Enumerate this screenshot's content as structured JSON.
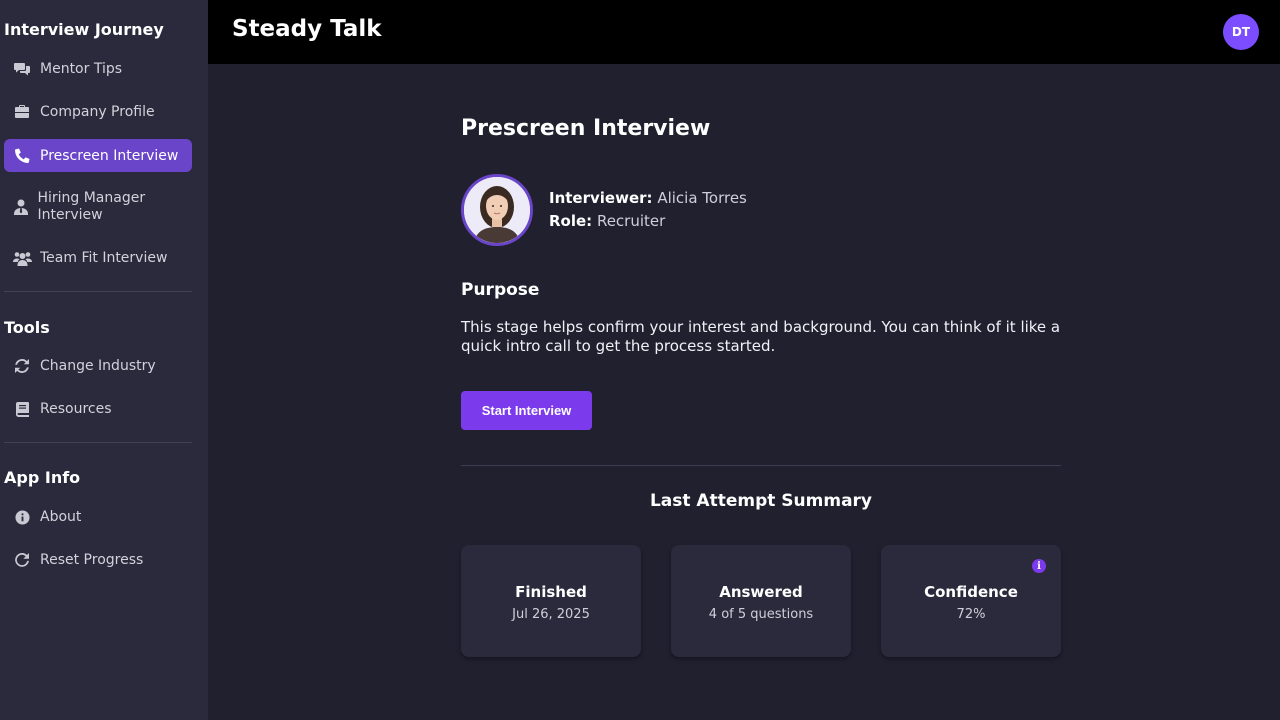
{
  "sidebar": {
    "journey_title": "Interview Journey",
    "journey_items": [
      {
        "label": "Mentor Tips",
        "icon": "comments-icon"
      },
      {
        "label": "Company Profile",
        "icon": "briefcase-icon"
      },
      {
        "label": "Prescreen Interview",
        "icon": "phone-icon",
        "active": true
      },
      {
        "label": "Hiring Manager Interview",
        "icon": "user-tie-icon"
      },
      {
        "label": "Team Fit Interview",
        "icon": "users-icon"
      }
    ],
    "tools_title": "Tools",
    "tools_items": [
      {
        "label": "Change Industry",
        "icon": "refresh-icon"
      },
      {
        "label": "Resources",
        "icon": "book-icon"
      }
    ],
    "appinfo_title": "App Info",
    "appinfo_items": [
      {
        "label": "About",
        "icon": "info-circle-icon"
      },
      {
        "label": "Reset Progress",
        "icon": "reset-icon"
      }
    ]
  },
  "header": {
    "app_title": "Steady Talk",
    "user_initials": "DT"
  },
  "main": {
    "page_title": "Prescreen Interview",
    "interviewer_label": "Interviewer:",
    "interviewer_name": "Alicia Torres",
    "role_label": "Role:",
    "role_value": "Recruiter",
    "purpose_title": "Purpose",
    "purpose_text": "This stage helps confirm your interest and background. You can think of it like a quick intro call to get the process started.",
    "start_button": "Start Interview",
    "summary_title": "Last Attempt Summary",
    "cards": [
      {
        "label": "Finished",
        "value": "Jul 26, 2025"
      },
      {
        "label": "Answered",
        "value": "4 of 5 questions"
      },
      {
        "label": "Confidence",
        "value": "72%"
      }
    ]
  },
  "colors": {
    "accent": "#7c3aed",
    "active_nav": "#6b45c9",
    "sidebar_bg": "#2a2a3c",
    "main_bg": "#20202f",
    "topbar_bg": "#000000"
  }
}
